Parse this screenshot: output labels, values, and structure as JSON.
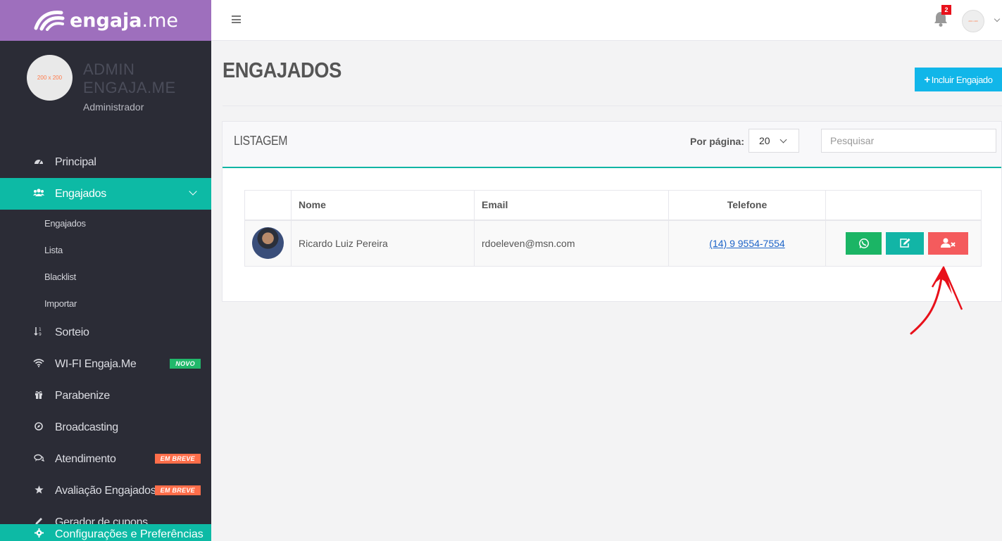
{
  "brand": {
    "bold": "engaja",
    "light": ".me"
  },
  "profile": {
    "avatar_text": "200 x 200",
    "name": "ADMIN ENGAJA.ME",
    "role": "Administrador"
  },
  "sidebar": {
    "items": [
      {
        "label": "Principal"
      },
      {
        "label": "Engajados"
      },
      {
        "label": "Sorteio"
      },
      {
        "label": "WI-FI Engaja.Me",
        "badge": "NOVO"
      },
      {
        "label": "Parabenize"
      },
      {
        "label": "Broadcasting"
      },
      {
        "label": "Atendimento",
        "badge": "EM BREVE"
      },
      {
        "label": "Avaliação Engajados",
        "badge": "EM BREVE"
      },
      {
        "label": "Gerador de cupons"
      }
    ],
    "submenu": [
      "Engajados",
      "Lista",
      "Blacklist",
      "Importar"
    ],
    "footer": "Configurações e Preferências"
  },
  "topbar": {
    "notification_count": "2",
    "avatar_text": "200 x 200"
  },
  "page": {
    "title": "ENGAJADOS",
    "add_button": "Incluir Engajado"
  },
  "panel": {
    "title": "LISTAGEM",
    "per_page_label": "Por página:",
    "per_page_value": "20",
    "search_placeholder": "Pesquisar"
  },
  "table": {
    "headers": [
      "",
      "Nome",
      "Email",
      "Telefone",
      ""
    ],
    "rows": [
      {
        "name": "Ricardo Luiz Pereira",
        "email": "rdoeleven@msn.com",
        "phone": "(14) 9 9554-7554"
      }
    ]
  },
  "colors": {
    "brand": "#9e6fbd",
    "sidebar": "#2b2c36",
    "accent": "#0dbaa5",
    "primary_button": "#11b6e9",
    "whatsapp": "#1bb565",
    "delete": "#f45b5d",
    "annotation_arrow": "#e8101a"
  }
}
